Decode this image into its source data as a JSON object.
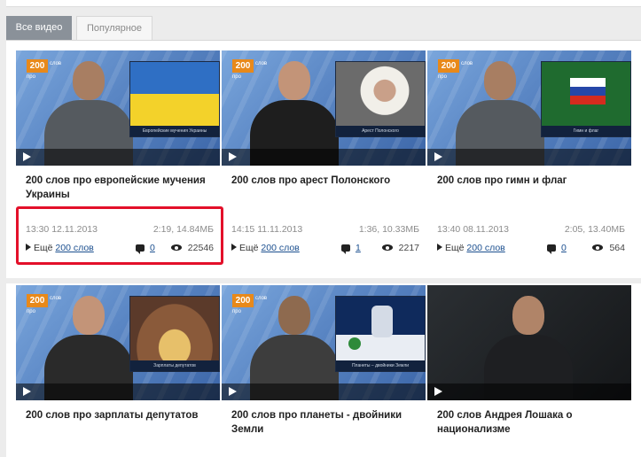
{
  "tabs": [
    {
      "label": "Все видео",
      "active": true
    },
    {
      "label": "Популярное",
      "active": false
    }
  ],
  "videos": [
    {
      "title": "200 слов про европейские мучения Украины",
      "time": "13:30 12.11.2013",
      "duration": "2:19, 14.84МБ",
      "more_prefix": "Ещё",
      "more_link": "200 слов",
      "comments": "0",
      "views": "22546",
      "inset_caption": "Европейские мучения Украины",
      "logo": "200",
      "logo_sub": "слов",
      "logo_sub2": "про"
    },
    {
      "title": "200 слов про арест Полонского",
      "time": "14:15 11.11.2013",
      "duration": "1:36, 10.33МБ",
      "more_prefix": "Ещё",
      "more_link": "200 слов",
      "comments": "1",
      "views": "2217",
      "inset_caption": "Арест Полонского",
      "logo": "200",
      "logo_sub": "слов",
      "logo_sub2": "про"
    },
    {
      "title": "200 слов про гимн и флаг",
      "time": "13:40 08.11.2013",
      "duration": "2:05, 13.40МБ",
      "more_prefix": "Ещё",
      "more_link": "200 слов",
      "comments": "0",
      "views": "564",
      "inset_caption": "Гимн и флаг",
      "logo": "200",
      "logo_sub": "слов",
      "logo_sub2": "про"
    },
    {
      "title": "200 слов про зарплаты депутатов",
      "inset_caption": "Зарплаты депутатов",
      "logo": "200",
      "logo_sub": "слов",
      "logo_sub2": "про"
    },
    {
      "title": "200 слов про планеты - двойники Земли",
      "inset_caption": "Планеты – двойники Земли",
      "logo": "200",
      "logo_sub": "слов",
      "logo_sub2": "про"
    },
    {
      "title": "200 слов Андрея Лошака о национализме"
    }
  ]
}
